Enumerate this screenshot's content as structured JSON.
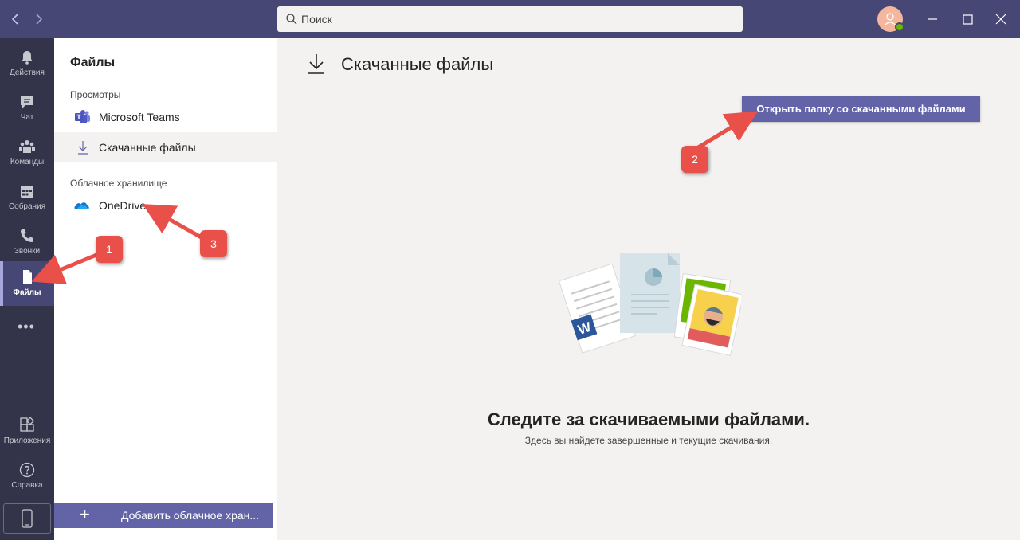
{
  "titlebar": {
    "search_placeholder": "Поиск"
  },
  "rail": {
    "items": [
      {
        "label": "Действия",
        "icon": "bell-icon"
      },
      {
        "label": "Чат",
        "icon": "chat-icon"
      },
      {
        "label": "Команды",
        "icon": "teams-icon"
      },
      {
        "label": "Собрания",
        "icon": "calendar-icon"
      },
      {
        "label": "Звонки",
        "icon": "phone-icon"
      },
      {
        "label": "Файлы",
        "icon": "file-icon",
        "active": true
      }
    ],
    "more": "•••",
    "apps": "Приложения",
    "help": "Справка"
  },
  "panel": {
    "title": "Файлы",
    "views_label": "Просмотры",
    "views": [
      {
        "label": "Microsoft Teams",
        "icon": "microsoft-teams-icon"
      },
      {
        "label": "Скачанные файлы",
        "icon": "download-icon",
        "active": true
      }
    ],
    "cloud_label": "Облачное хранилище",
    "cloud": [
      {
        "label": "OneDrive",
        "icon": "onedrive-icon"
      }
    ],
    "add_cloud": "Добавить облачное хран..."
  },
  "main": {
    "title": "Скачанные файлы",
    "open_folder_button": "Открыть папку со скачанными файлами",
    "empty_title": "Следите за скачиваемыми файлами.",
    "empty_subtitle": "Здесь вы найдете завершенные и текущие скачивания."
  },
  "annotations": {
    "badge_1": "1",
    "badge_2": "2",
    "badge_3": "3",
    "color": "#e9504a"
  },
  "colors": {
    "accent": "#6264a7",
    "titlebar": "#464775",
    "rail": "#33344a"
  }
}
